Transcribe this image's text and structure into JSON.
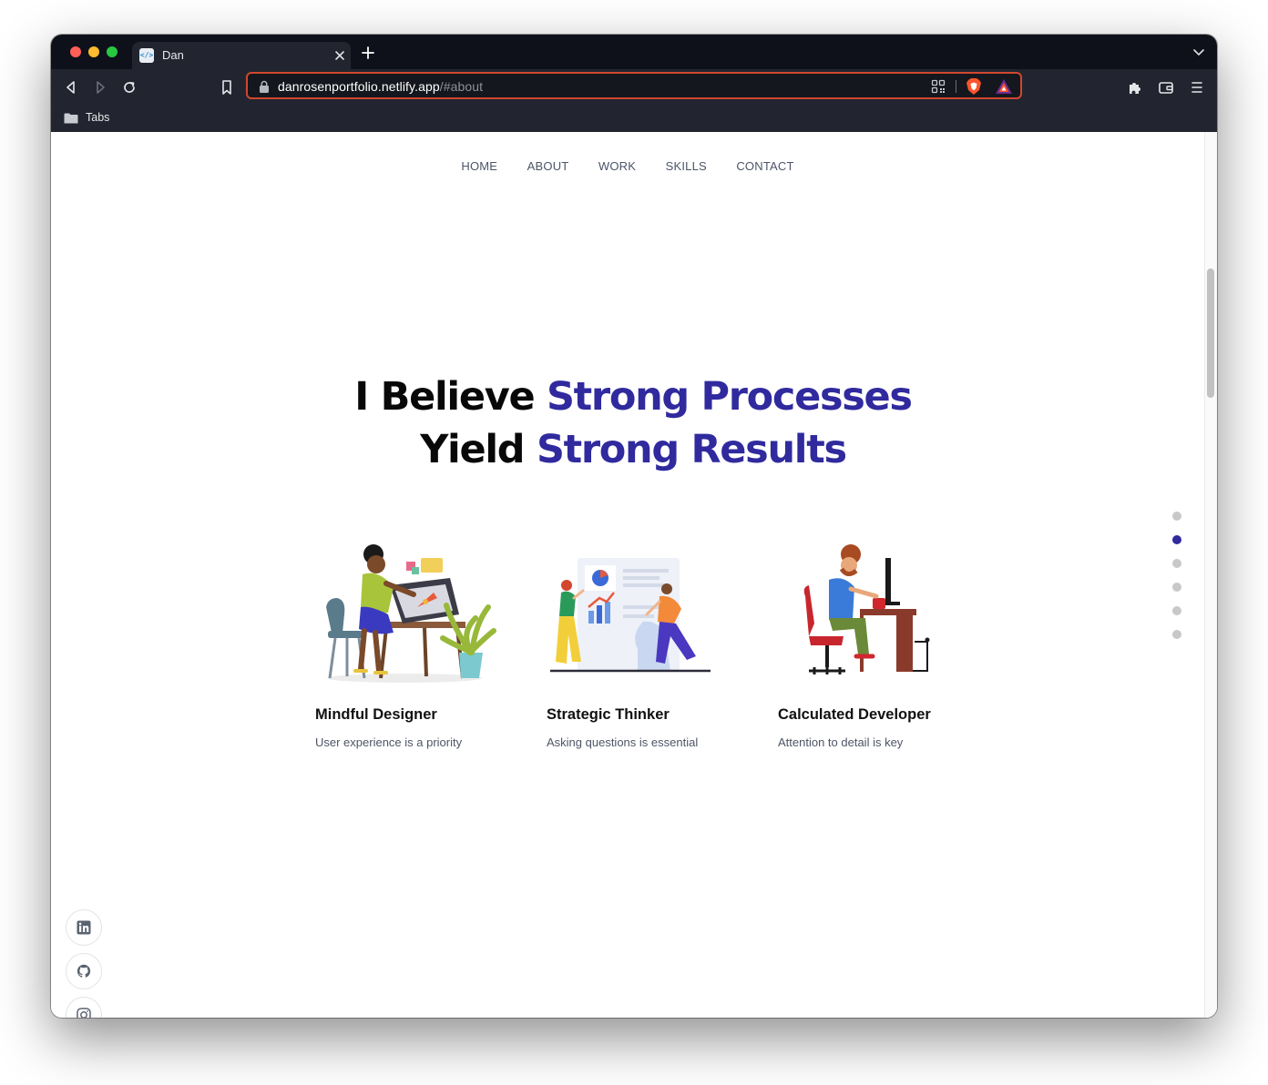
{
  "browser": {
    "tab_title": "Dan",
    "tab_favicon": "</>",
    "url_host": "danrosenportfolio.netlify.app",
    "url_hash": "/#about",
    "bookmark_folder": "Tabs",
    "icons": [
      "back-icon",
      "forward-icon",
      "reload-icon",
      "bookmark-icon",
      "lock-icon",
      "qr-code-icon",
      "brave-shield-icon",
      "brave-rewards-icon",
      "extensions-icon",
      "wallet-icon",
      "menu-icon"
    ]
  },
  "nav": {
    "items": [
      {
        "label": "HOME"
      },
      {
        "label": "ABOUT"
      },
      {
        "label": "WORK"
      },
      {
        "label": "SKILLS"
      },
      {
        "label": "CONTACT"
      }
    ]
  },
  "hero": {
    "line1_plain": "I Believe ",
    "line1_accent": "Strong Processes",
    "line2_plain": "Yield ",
    "line2_accent": "Strong Results"
  },
  "features": [
    {
      "title": "Mindful Designer",
      "description": "User experience is a priority"
    },
    {
      "title": "Strategic Thinker",
      "description": "Asking questions is essential"
    },
    {
      "title": "Calculated Developer",
      "description": "Attention to detail is key"
    }
  ],
  "section_dots": {
    "count": 6,
    "active_index": 1
  },
  "social": [
    "linkedin-icon",
    "github-icon",
    "instagram-icon"
  ],
  "colors": {
    "accent": "#302a9e",
    "nav_text": "#4b5568",
    "chrome_bg": "#22252f",
    "url_border": "#d2472e"
  }
}
